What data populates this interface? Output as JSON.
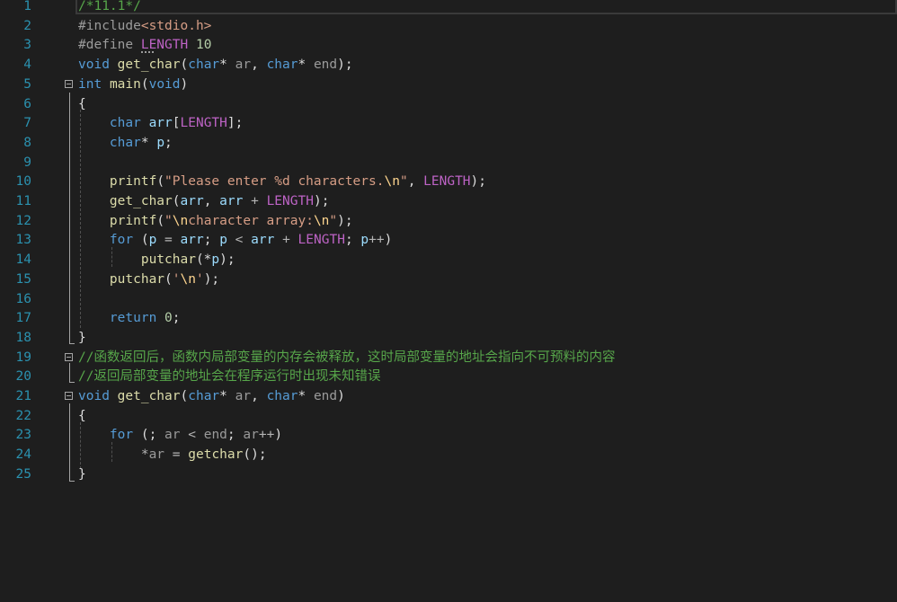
{
  "editor": {
    "lines": [
      {
        "number": "1",
        "tokens": [
          {
            "t": "/*11.1*/",
            "c": "cm"
          }
        ]
      },
      {
        "number": "2",
        "tokens": [
          {
            "t": "#include",
            "c": "pp"
          },
          {
            "t": "<stdio.h>",
            "c": "str"
          }
        ]
      },
      {
        "number": "3",
        "tokens": [
          {
            "t": "#define ",
            "c": "pp"
          },
          {
            "t": "LENGTH",
            "c": "mac"
          },
          {
            "t": " ",
            "c": "pl"
          },
          {
            "t": "10",
            "c": "num"
          }
        ]
      },
      {
        "number": "4",
        "tokens": [
          {
            "t": "void",
            "c": "kw"
          },
          {
            "t": " ",
            "c": "pl"
          },
          {
            "t": "get_char",
            "c": "fn"
          },
          {
            "t": "(",
            "c": "pl"
          },
          {
            "t": "char",
            "c": "kw"
          },
          {
            "t": "* ",
            "c": "pl"
          },
          {
            "t": "ar",
            "c": "par"
          },
          {
            "t": ", ",
            "c": "pl"
          },
          {
            "t": "char",
            "c": "kw"
          },
          {
            "t": "* ",
            "c": "pl"
          },
          {
            "t": "end",
            "c": "par"
          },
          {
            "t": ");",
            "c": "pl"
          }
        ]
      },
      {
        "number": "5",
        "tokens": [
          {
            "t": "int",
            "c": "kw"
          },
          {
            "t": " ",
            "c": "pl"
          },
          {
            "t": "main",
            "c": "fn"
          },
          {
            "t": "(",
            "c": "pl"
          },
          {
            "t": "void",
            "c": "kw"
          },
          {
            "t": ")",
            "c": "pl"
          }
        ]
      },
      {
        "number": "6",
        "tokens": [
          {
            "t": "{",
            "c": "pl"
          }
        ]
      },
      {
        "number": "7",
        "tokens": [
          {
            "t": "    ",
            "c": "pl"
          },
          {
            "t": "char",
            "c": "kw"
          },
          {
            "t": " ",
            "c": "pl"
          },
          {
            "t": "arr",
            "c": "var"
          },
          {
            "t": "[",
            "c": "pl"
          },
          {
            "t": "LENGTH",
            "c": "mac"
          },
          {
            "t": "];",
            "c": "pl"
          }
        ]
      },
      {
        "number": "8",
        "tokens": [
          {
            "t": "    ",
            "c": "pl"
          },
          {
            "t": "char",
            "c": "kw"
          },
          {
            "t": "* ",
            "c": "pl"
          },
          {
            "t": "p",
            "c": "var"
          },
          {
            "t": ";",
            "c": "pl"
          }
        ]
      },
      {
        "number": "9",
        "tokens": []
      },
      {
        "number": "10",
        "tokens": [
          {
            "t": "    ",
            "c": "pl"
          },
          {
            "t": "printf",
            "c": "fn"
          },
          {
            "t": "(",
            "c": "pl"
          },
          {
            "t": "\"Please enter %d characters.",
            "c": "str"
          },
          {
            "t": "\\n",
            "c": "esc"
          },
          {
            "t": "\"",
            "c": "str"
          },
          {
            "t": ", ",
            "c": "pl"
          },
          {
            "t": "LENGTH",
            "c": "mac"
          },
          {
            "t": ");",
            "c": "pl"
          }
        ]
      },
      {
        "number": "11",
        "tokens": [
          {
            "t": "    ",
            "c": "pl"
          },
          {
            "t": "get_char",
            "c": "fn"
          },
          {
            "t": "(",
            "c": "pl"
          },
          {
            "t": "arr",
            "c": "var"
          },
          {
            "t": ", ",
            "c": "pl"
          },
          {
            "t": "arr",
            "c": "var"
          },
          {
            "t": " + ",
            "c": "op"
          },
          {
            "t": "LENGTH",
            "c": "mac"
          },
          {
            "t": ");",
            "c": "pl"
          }
        ]
      },
      {
        "number": "12",
        "tokens": [
          {
            "t": "    ",
            "c": "pl"
          },
          {
            "t": "printf",
            "c": "fn"
          },
          {
            "t": "(",
            "c": "pl"
          },
          {
            "t": "\"",
            "c": "str"
          },
          {
            "t": "\\n",
            "c": "esc"
          },
          {
            "t": "character array:",
            "c": "str"
          },
          {
            "t": "\\n",
            "c": "esc"
          },
          {
            "t": "\"",
            "c": "str"
          },
          {
            "t": ");",
            "c": "pl"
          }
        ]
      },
      {
        "number": "13",
        "tokens": [
          {
            "t": "    ",
            "c": "pl"
          },
          {
            "t": "for",
            "c": "kw"
          },
          {
            "t": " (",
            "c": "pl"
          },
          {
            "t": "p",
            "c": "var"
          },
          {
            "t": " = ",
            "c": "op"
          },
          {
            "t": "arr",
            "c": "var"
          },
          {
            "t": "; ",
            "c": "pl"
          },
          {
            "t": "p",
            "c": "var"
          },
          {
            "t": " < ",
            "c": "op"
          },
          {
            "t": "arr",
            "c": "var"
          },
          {
            "t": " + ",
            "c": "op"
          },
          {
            "t": "LENGTH",
            "c": "mac"
          },
          {
            "t": "; ",
            "c": "pl"
          },
          {
            "t": "p",
            "c": "var"
          },
          {
            "t": "++",
            "c": "op"
          },
          {
            "t": ")",
            "c": "pl"
          }
        ]
      },
      {
        "number": "14",
        "tokens": [
          {
            "t": "        ",
            "c": "pl"
          },
          {
            "t": "putchar",
            "c": "fn"
          },
          {
            "t": "(*",
            "c": "pl"
          },
          {
            "t": "p",
            "c": "var"
          },
          {
            "t": ");",
            "c": "pl"
          }
        ]
      },
      {
        "number": "15",
        "tokens": [
          {
            "t": "    ",
            "c": "pl"
          },
          {
            "t": "putchar",
            "c": "fn"
          },
          {
            "t": "(",
            "c": "pl"
          },
          {
            "t": "'",
            "c": "str"
          },
          {
            "t": "\\n",
            "c": "esc"
          },
          {
            "t": "'",
            "c": "str"
          },
          {
            "t": ");",
            "c": "pl"
          }
        ]
      },
      {
        "number": "16",
        "tokens": []
      },
      {
        "number": "17",
        "tokens": [
          {
            "t": "    ",
            "c": "pl"
          },
          {
            "t": "return",
            "c": "kw"
          },
          {
            "t": " ",
            "c": "pl"
          },
          {
            "t": "0",
            "c": "num"
          },
          {
            "t": ";",
            "c": "pl"
          }
        ]
      },
      {
        "number": "18",
        "tokens": [
          {
            "t": "}",
            "c": "pl"
          }
        ]
      },
      {
        "number": "19",
        "tokens": [
          {
            "t": "//函数返回后，函数内局部变量的内存会被释放，这时局部变量的地址会指向不可预料的内容",
            "c": "cm"
          }
        ]
      },
      {
        "number": "20",
        "tokens": [
          {
            "t": "//返回局部变量的地址会在程序运行时出现未知错误",
            "c": "cm"
          }
        ]
      },
      {
        "number": "21",
        "tokens": [
          {
            "t": "void",
            "c": "kw"
          },
          {
            "t": " ",
            "c": "pl"
          },
          {
            "t": "get_char",
            "c": "fn"
          },
          {
            "t": "(",
            "c": "pl"
          },
          {
            "t": "char",
            "c": "kw"
          },
          {
            "t": "* ",
            "c": "pl"
          },
          {
            "t": "ar",
            "c": "par"
          },
          {
            "t": ", ",
            "c": "pl"
          },
          {
            "t": "char",
            "c": "kw"
          },
          {
            "t": "* ",
            "c": "pl"
          },
          {
            "t": "end",
            "c": "par"
          },
          {
            "t": ")",
            "c": "pl"
          }
        ]
      },
      {
        "number": "22",
        "tokens": [
          {
            "t": "{",
            "c": "pl"
          }
        ]
      },
      {
        "number": "23",
        "tokens": [
          {
            "t": "    ",
            "c": "pl"
          },
          {
            "t": "for",
            "c": "kw"
          },
          {
            "t": " (; ",
            "c": "pl"
          },
          {
            "t": "ar",
            "c": "par"
          },
          {
            "t": " < ",
            "c": "op"
          },
          {
            "t": "end",
            "c": "par"
          },
          {
            "t": "; ",
            "c": "pl"
          },
          {
            "t": "ar",
            "c": "par"
          },
          {
            "t": "++",
            "c": "op"
          },
          {
            "t": ")",
            "c": "pl"
          }
        ]
      },
      {
        "number": "24",
        "tokens": [
          {
            "t": "        ",
            "c": "pl"
          },
          {
            "t": "*",
            "c": "op"
          },
          {
            "t": "ar",
            "c": "par"
          },
          {
            "t": " = ",
            "c": "op"
          },
          {
            "t": "getchar",
            "c": "fn"
          },
          {
            "t": "();",
            "c": "pl"
          }
        ]
      },
      {
        "number": "25",
        "tokens": [
          {
            "t": "}",
            "c": "pl"
          }
        ]
      }
    ],
    "fold_markers": [
      "5",
      "19",
      "21"
    ]
  }
}
